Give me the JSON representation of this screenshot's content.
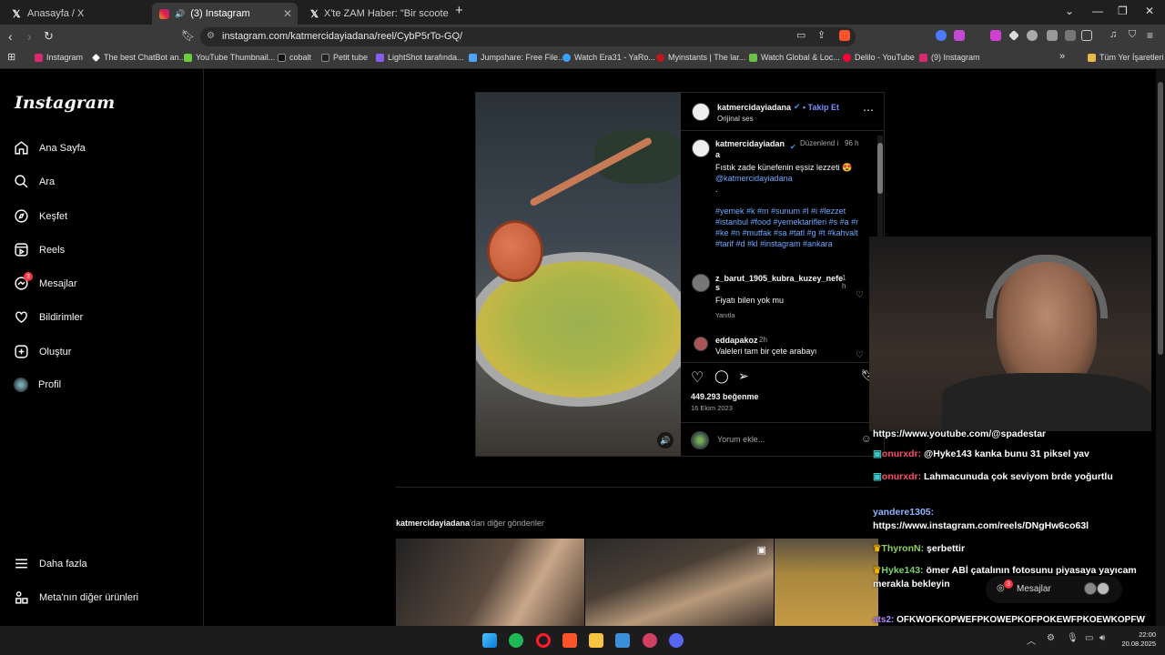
{
  "tabs": [
    {
      "title": "Anasayfa / X",
      "icon": "x-logo-icon"
    },
    {
      "title": "(3) Instagram",
      "icon": "instagram-logo-icon"
    },
    {
      "title": "X'te ZAM Haber: \"Bir scooter sürücü"
    }
  ],
  "address": {
    "url": "instagram.com/katmercidayiadana/reel/CybP5rTo-GQ/"
  },
  "bookmarks": [
    "Instagram",
    "The best ChatBot an...",
    "YouTube Thumbnail...",
    "cobalt",
    "Petit tube",
    "LightShot tarafında...",
    "Jumpshare: Free File...",
    "Watch Era31 - YaRo...",
    "Myinstants | The lar...",
    "Watch Global & Loc...",
    "Delilo - YouTube",
    "(9) Instagram"
  ],
  "bookmarks_folder": "Tüm Yer İşaretleri",
  "sidebar": {
    "logo": "Instagram",
    "items": [
      {
        "label": "Ana Sayfa",
        "icon": "home-icon"
      },
      {
        "label": "Ara",
        "icon": "search-icon"
      },
      {
        "label": "Keşfet",
        "icon": "compass-icon"
      },
      {
        "label": "Reels",
        "icon": "reels-icon"
      },
      {
        "label": "Mesajlar",
        "icon": "messenger-icon",
        "badge": "3"
      },
      {
        "label": "Bildirimler",
        "icon": "heart-icon"
      },
      {
        "label": "Oluştur",
        "icon": "plus-square-icon"
      },
      {
        "label": "Profil",
        "icon": "avatar"
      }
    ],
    "bottom": [
      {
        "label": "Daha fazla",
        "icon": "menu-icon"
      },
      {
        "label": "Meta'nın diğer ürünleri",
        "icon": "grid-icon"
      }
    ]
  },
  "post": {
    "username": "katmercidayiadana",
    "follow": "Takip Et",
    "subtitle": "Orijinal ses",
    "caption_user_1": "katmercidayiadan",
    "caption_user_2": "a",
    "edited": "Düzenlend i",
    "caption_time": "96 h",
    "caption_text": "Fıstık zade künefenin eşsiz lezzeti 😍",
    "caption_mention": "@katmercidayiadana",
    "caption_dot": ".",
    "hashtags": "#yemek #k #m #sunum #l #i #lezzet #istanbul #food #yemektarifleri #s #a #r #ke #n #mutfak #sa #tatl #g #t #kahvalt #tarif #d #kl #instagram #ankara",
    "comments": [
      {
        "user": "z_barut_1905_kubra_kuzey_nefe s",
        "time": "1 h",
        "text": "Fiyatı bilen yok mu",
        "reply": "Yanıtla"
      },
      {
        "user": "eddapakoz",
        "time": "2h",
        "text": "Valeleri tam bir çete arabayı"
      }
    ],
    "likes": "449.293 beğenme",
    "date": "16 Ekim 2023",
    "comment_placeholder": "Yorum ekle..."
  },
  "more": {
    "user": "katmercidayiadana",
    "suffix": "'dan diğer gönderiler"
  },
  "chat": [
    {
      "user": "",
      "text": "https://www.youtube.com/@spadestar",
      "color": "#ffffff"
    },
    {
      "user": "onurxdr:",
      "text": "@Hyke143 kanka bunu 31 piksel yav",
      "color": "#ff4d6d"
    },
    {
      "user": "onurxdr:",
      "text": "Lahmacunuda çok seviyom brde yoğurtlu",
      "color": "#ff4d6d"
    },
    {
      "user": "yandere1305:",
      "text": "https://www.instagram.com/reels/DNgHw6co63l",
      "color": "#8fb4ff"
    },
    {
      "user": "ThyronN:",
      "text": "şerbettir",
      "color": "#8fd15c"
    },
    {
      "user": "Hyke143:",
      "text": "ömer ABİ çatalının fotosunu piyasaya yayıcam merakla bekleyin",
      "color": "#7ad36e"
    },
    {
      "user": "ats2:",
      "text": "OFKWOFKOPWEFPKOWEPKOFPOKEWFPKOEWKOPFW",
      "color": "#b58cff"
    }
  ],
  "dm_widget": {
    "label": "Mesajlar",
    "badge": "3"
  },
  "taskbar": {
    "time": "22:00",
    "date": "20.08.2025"
  }
}
